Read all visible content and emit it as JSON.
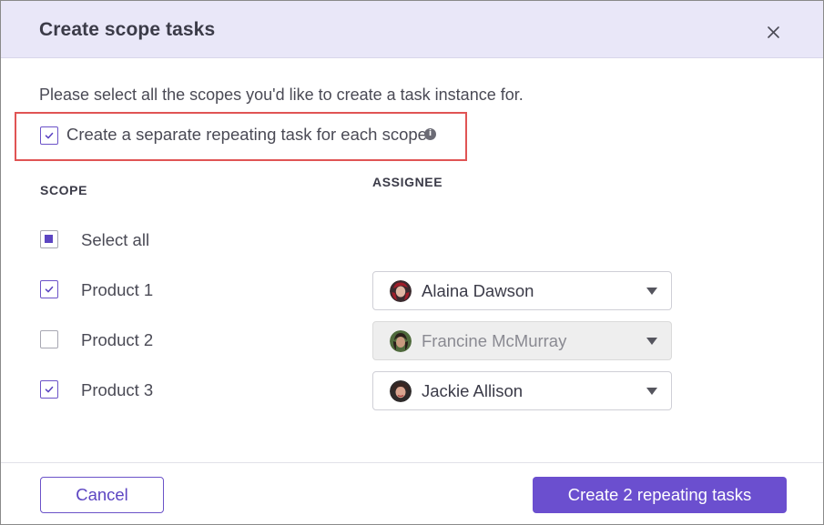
{
  "dialog": {
    "title": "Create scope tasks",
    "close_icon": "close-icon",
    "intro": "Please select all the scopes you'd like to create a task instance for.",
    "separate_option": {
      "label": "Create a separate repeating task for each scope",
      "checked": true,
      "info_icon": "info-icon",
      "info_glyph": "i"
    },
    "columns": {
      "scope": "SCOPE",
      "assignee": "ASSIGNEE"
    },
    "select_all": {
      "label": "Select all",
      "state": "indeterminate"
    },
    "rows": [
      {
        "scope": "Product 1",
        "checked": true,
        "assignee": "Alaina Dawson",
        "disabled": false
      },
      {
        "scope": "Product 2",
        "checked": false,
        "assignee": "Francine McMurray",
        "disabled": true
      },
      {
        "scope": "Product 3",
        "checked": true,
        "assignee": "Jackie Allison",
        "disabled": false
      }
    ],
    "buttons": {
      "cancel": "Cancel",
      "create": "Create 2 repeating tasks"
    }
  },
  "colors": {
    "header_bg": "#e9e7f8",
    "accent": "#6b4fcf",
    "highlight_border": "#e05454"
  }
}
